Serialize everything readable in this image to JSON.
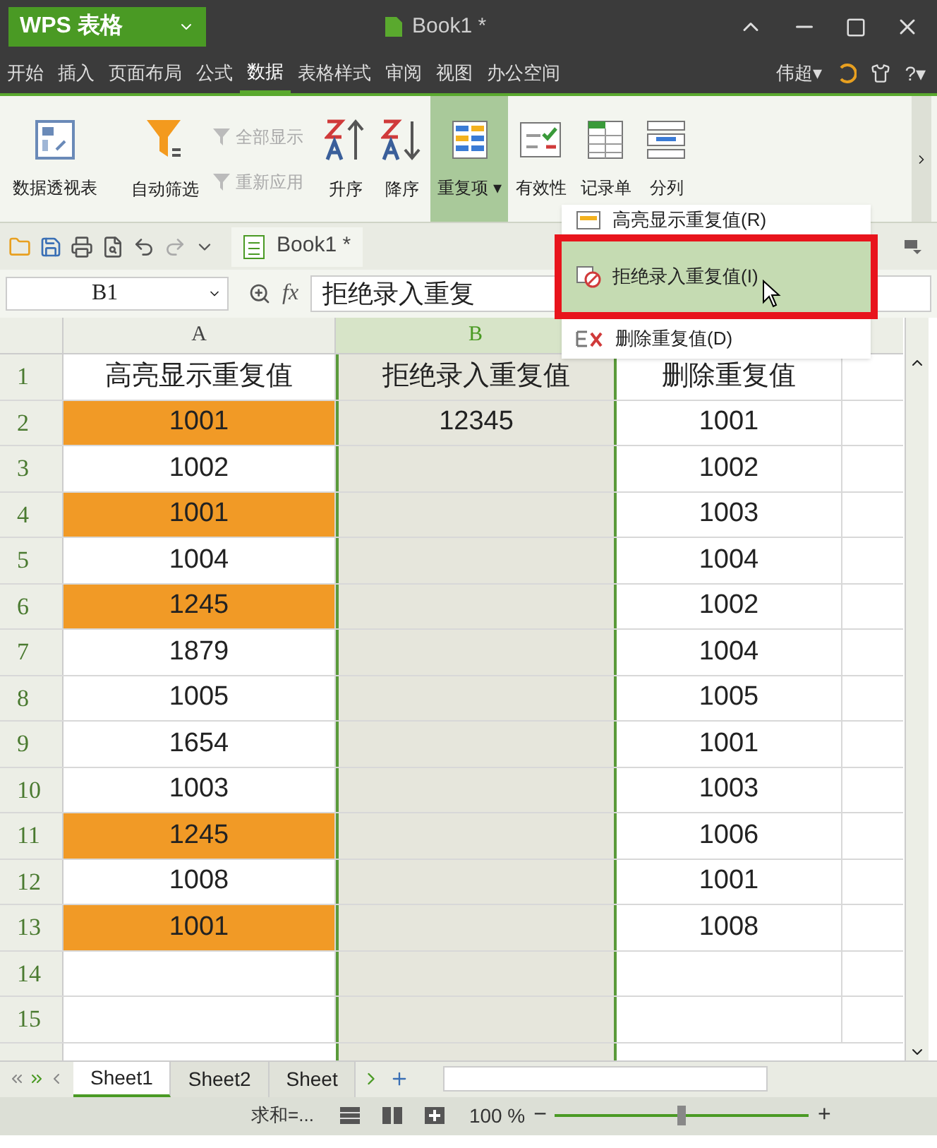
{
  "app": {
    "name": "WPS 表格",
    "document": "Book1 *"
  },
  "menu": [
    {
      "label": "开始",
      "selected": false
    },
    {
      "label": "插入",
      "selected": false
    },
    {
      "label": "页面布局",
      "selected": false
    },
    {
      "label": "公式",
      "selected": false
    },
    {
      "label": "数据",
      "selected": true
    },
    {
      "label": "表格样式",
      "selected": false
    },
    {
      "label": "审阅",
      "selected": false
    },
    {
      "label": "视图",
      "selected": false
    },
    {
      "label": "办公空间",
      "selected": false
    }
  ],
  "user": "伟超▾",
  "help": "?▾",
  "ribbon": [
    {
      "kind": "large",
      "label": "数据透视表",
      "selected": false
    },
    {
      "kind": "large",
      "label": "自动筛选",
      "selected": false
    },
    {
      "kind": "small",
      "label": "全部显示",
      "disabled": true,
      "label2": "重新应用",
      "disabled2": true
    },
    {
      "kind": "large",
      "label": "升序",
      "selected": false
    },
    {
      "kind": "large",
      "label": "降序",
      "selected": false
    },
    {
      "kind": "large",
      "label": "重复项 ▾",
      "selected": true
    },
    {
      "kind": "large",
      "label": "有效性",
      "selected": false
    },
    {
      "kind": "large",
      "label": "记录单",
      "selected": false
    },
    {
      "kind": "large",
      "label": "分列",
      "selected": false
    }
  ],
  "quick_bar": {
    "tab": "Book1 *"
  },
  "formula_bar": {
    "cell": "B1",
    "fx": "fx",
    "value": "拒绝录入重复"
  },
  "columns": [
    {
      "label": "A",
      "selected": false
    },
    {
      "label": "B",
      "selected": true
    }
  ],
  "rows": [
    {
      "n": "1",
      "a": "高亮显示重复值",
      "a_highlight": false,
      "b": "拒绝录入重复值",
      "c": "删除重复值"
    },
    {
      "n": "2",
      "a": "1001",
      "a_highlight": true,
      "b": "12345",
      "c": "1001"
    },
    {
      "n": "3",
      "a": "1002",
      "a_highlight": false,
      "c": "1002"
    },
    {
      "n": "4",
      "a": "1001",
      "a_highlight": true,
      "c": "1003"
    },
    {
      "n": "5",
      "a": "1004",
      "a_highlight": false,
      "c": "1004"
    },
    {
      "n": "6",
      "a": "1245",
      "a_highlight": true,
      "c": "1002"
    },
    {
      "n": "7",
      "a": "1879",
      "a_highlight": false,
      "c": "1004"
    },
    {
      "n": "8",
      "a": "1005",
      "a_highlight": false,
      "c": "1005"
    },
    {
      "n": "9",
      "a": "1654",
      "a_highlight": false,
      "c": "1001"
    },
    {
      "n": "10",
      "a": "1003",
      "a_highlight": false,
      "c": "1003"
    },
    {
      "n": "11",
      "a": "1245",
      "a_highlight": true,
      "c": "1006"
    },
    {
      "n": "12",
      "a": "1008",
      "a_highlight": false,
      "c": "1001"
    },
    {
      "n": "13",
      "a": "1001",
      "a_highlight": true,
      "c": "1008"
    },
    {
      "n": "14",
      "a_highlight": false
    },
    {
      "n": "15",
      "a_highlight": false
    }
  ],
  "dropdown_menu": [
    {
      "label": "高亮显示重复值(R)",
      "selected": false
    },
    {
      "label": "拒绝录入重复值(I)",
      "selected": true
    },
    {
      "label": "删除重复值(D)",
      "selected": false
    }
  ],
  "sheets": [
    {
      "label": "Sheet1",
      "selected": true
    },
    {
      "label": "Sheet2",
      "selected": false
    },
    {
      "label": "Sheet",
      "selected": false
    }
  ],
  "status": {
    "sum": "求和=...",
    "zoom": "100 %",
    "zoom_minus": "−",
    "zoom_plus": "+",
    "level": 0.5
  }
}
